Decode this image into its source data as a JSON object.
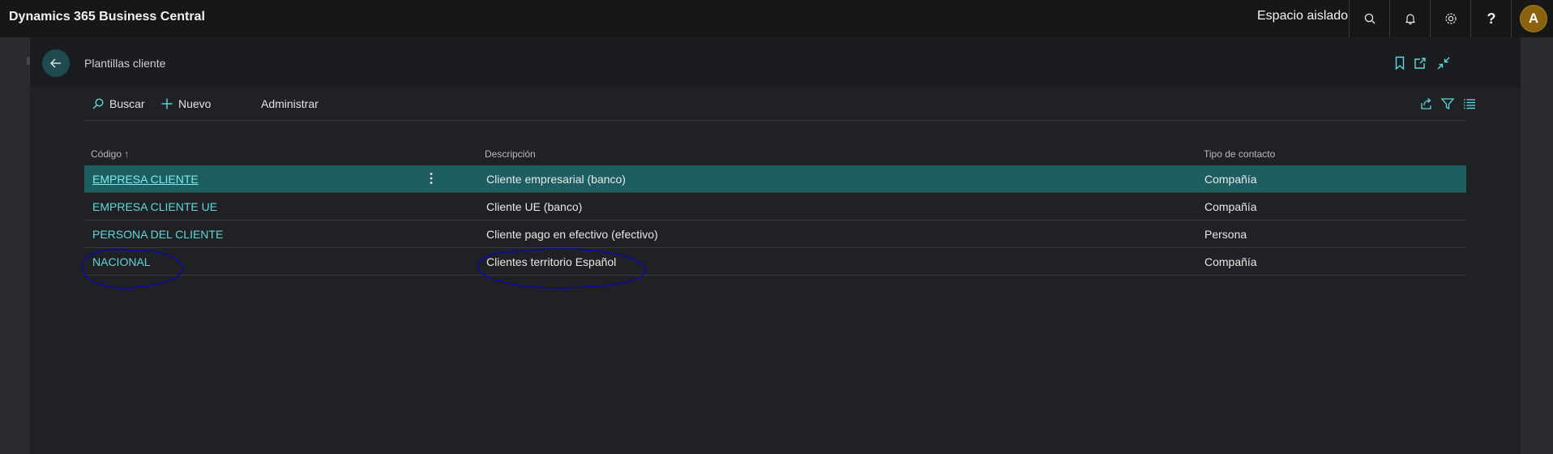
{
  "topbar": {
    "app_title": "Dynamics 365 Business Central",
    "environment": "Espacio aislado",
    "help_label": "?",
    "avatar_initial": "A",
    "avatar_color": "#8a6210"
  },
  "page": {
    "title": "Plantillas cliente",
    "header_icons": [
      "bookmark-icon",
      "open-in-new-window-icon",
      "collapse-icon"
    ]
  },
  "actions": {
    "search_label": "Buscar",
    "new_label": "Nuevo",
    "manage_label": "Administrar",
    "right_icons": [
      "share-icon",
      "filter-icon",
      "list-view-icon"
    ]
  },
  "grid": {
    "columns": {
      "code": "Código ↑",
      "description": "Descripción",
      "contact_type": "Tipo de contacto"
    },
    "rows": [
      {
        "code": "EMPRESA CLIENTE",
        "description": "Cliente empresarial (banco)",
        "contact_type": "Compañía",
        "selected": true
      },
      {
        "code": "EMPRESA CLIENTE UE",
        "description": "Cliente UE (banco)",
        "contact_type": "Compañía",
        "selected": false
      },
      {
        "code": "PERSONA DEL CLIENTE",
        "description": "Cliente pago en efectivo (efectivo)",
        "contact_type": "Persona",
        "selected": false
      },
      {
        "code": "NACIONAL",
        "description": "Clientes territorio Español",
        "contact_type": "Compañía",
        "selected": false
      }
    ]
  },
  "colors": {
    "accent": "#5fd8dc",
    "selected_row": "#1d5e61",
    "annotation": "#0a0aa8"
  }
}
